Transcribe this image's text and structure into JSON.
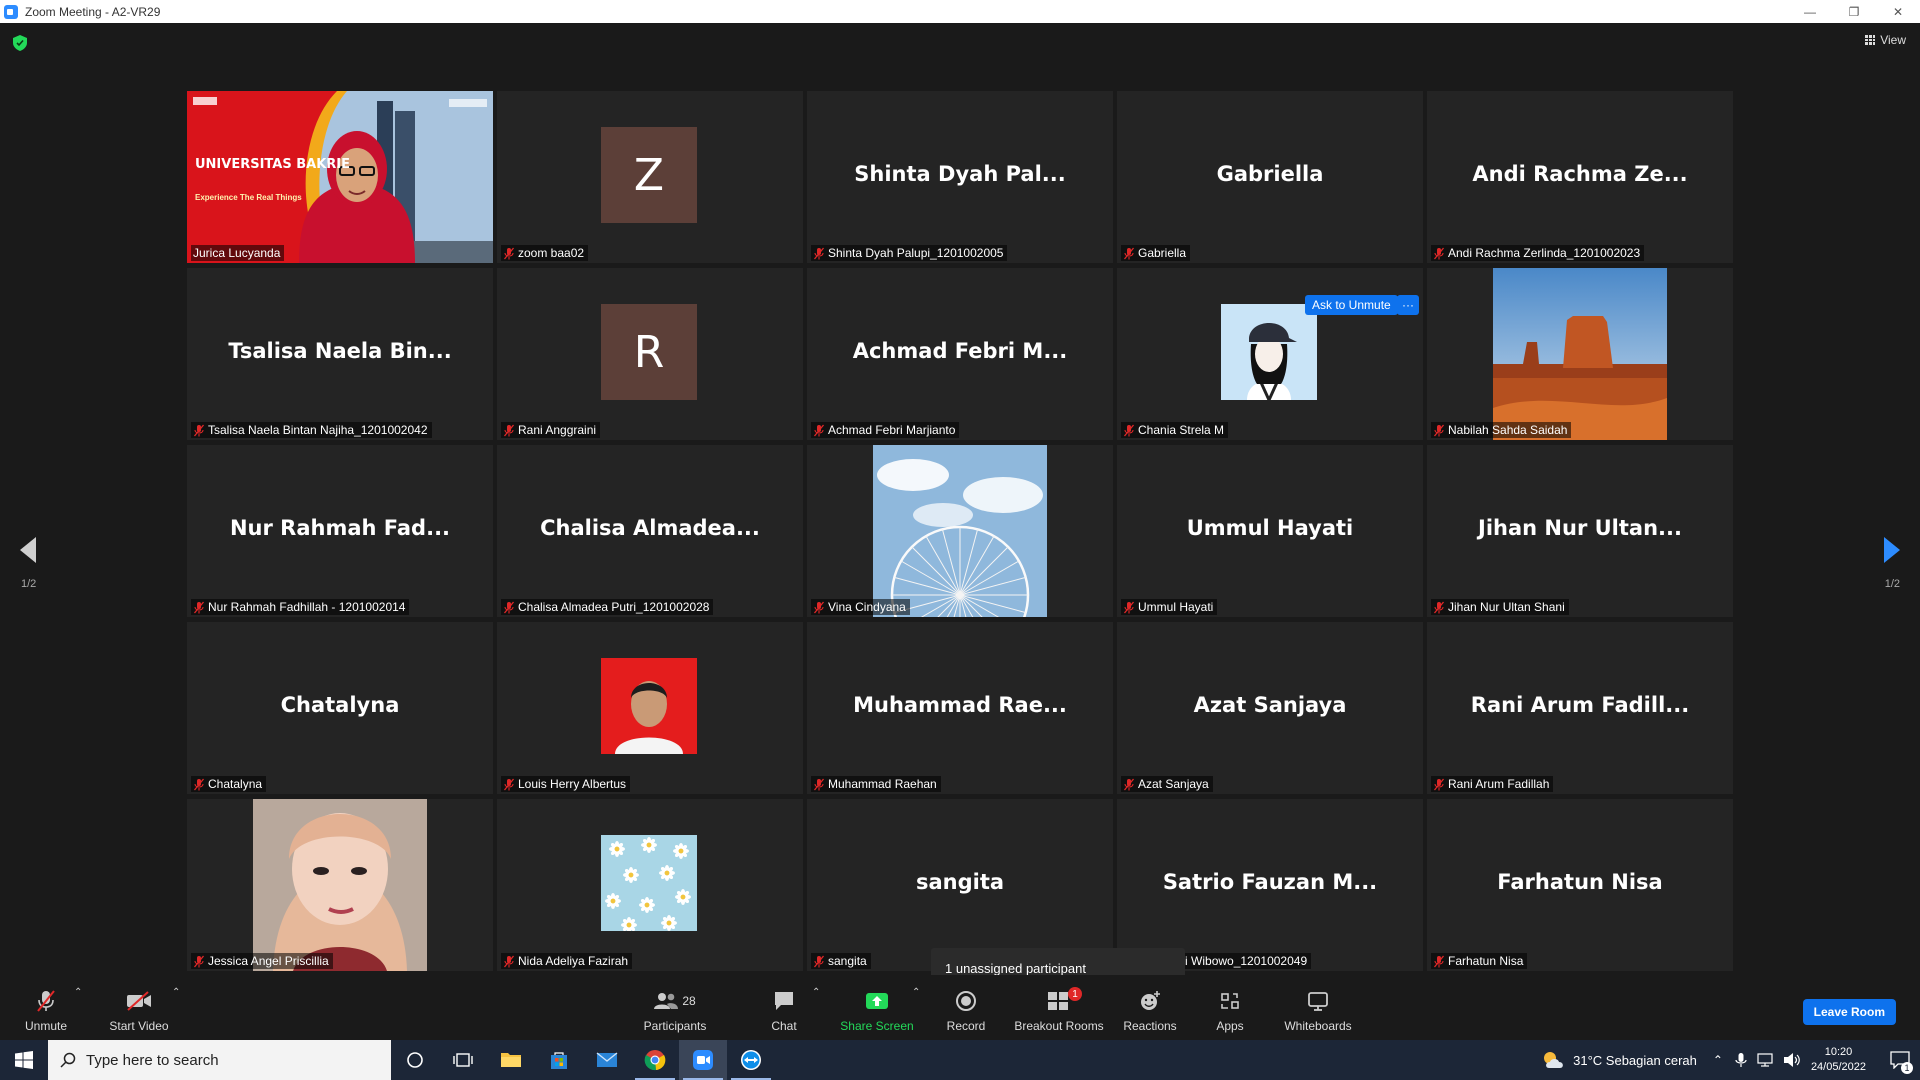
{
  "window": {
    "title": "Zoom Meeting - A2-VR29",
    "minimize": "—",
    "restore": "❐",
    "close": "✕"
  },
  "header": {
    "view_label": "View"
  },
  "tiles": [
    {
      "row": 0,
      "col": 0,
      "label": "Jurica Lucyanda",
      "type": "video",
      "slide_title": "UNIVERSITAS BAKRIE",
      "slide_subtitle": "Experience The Real Things",
      "muted": false,
      "active": true
    },
    {
      "row": 0,
      "col": 1,
      "label": "zoom baa02",
      "type": "letter",
      "letter": "Z",
      "muted": true
    },
    {
      "row": 0,
      "col": 2,
      "label": "Shinta Dyah Palupi_1201002005",
      "type": "name",
      "display": "Shinta Dyah Pal...",
      "muted": true
    },
    {
      "row": 0,
      "col": 3,
      "label": "Gabriella",
      "type": "name",
      "display": "Gabriella",
      "muted": true
    },
    {
      "row": 0,
      "col": 4,
      "label": "Andi Rachma Zerlinda_1201002023",
      "type": "name",
      "display": "Andi Rachma Ze...",
      "muted": true
    },
    {
      "row": 1,
      "col": 0,
      "label": "Tsalisa Naela Bintan Najiha_1201002042",
      "type": "name",
      "display": "Tsalisa Naela Bin...",
      "muted": true
    },
    {
      "row": 1,
      "col": 1,
      "label": "Rani Anggraini",
      "type": "letter",
      "letter": "R",
      "muted": true
    },
    {
      "row": 1,
      "col": 2,
      "label": "Achmad Febri Marjianto",
      "type": "name",
      "display": "Achmad Febri M...",
      "muted": true
    },
    {
      "row": 1,
      "col": 3,
      "label": "Chania Strela M",
      "type": "photo-girl",
      "muted": true
    },
    {
      "row": 1,
      "col": 4,
      "label": "Nabilah Sahda Saidah",
      "type": "photo-desert",
      "muted": true
    },
    {
      "row": 2,
      "col": 0,
      "label": "Nur Rahmah Fadhillah - 1201002014",
      "type": "name",
      "display": "Nur Rahmah Fad...",
      "muted": true
    },
    {
      "row": 2,
      "col": 1,
      "label": "Chalisa Almadea Putri_1201002028",
      "type": "name",
      "display": "Chalisa Almadea...",
      "muted": true
    },
    {
      "row": 2,
      "col": 2,
      "label": "Vina Cindyana",
      "type": "photo-wheel",
      "muted": true
    },
    {
      "row": 2,
      "col": 3,
      "label": "Ummul Hayati",
      "type": "name",
      "display": "Ummul Hayati",
      "muted": true
    },
    {
      "row": 2,
      "col": 4,
      "label": "Jihan Nur Ultan Shani",
      "type": "name",
      "display": "Jihan Nur Ultan...",
      "muted": true
    },
    {
      "row": 3,
      "col": 0,
      "label": "Chatalyna",
      "type": "name",
      "display": "Chatalyna",
      "muted": true
    },
    {
      "row": 3,
      "col": 1,
      "label": "Louis Herry Albertus",
      "type": "photo-man",
      "muted": true
    },
    {
      "row": 3,
      "col": 2,
      "label": "Muhammad Raehan",
      "type": "name",
      "display": "Muhammad Rae...",
      "muted": true
    },
    {
      "row": 3,
      "col": 3,
      "label": "Azat Sanjaya",
      "type": "name",
      "display": "Azat Sanjaya",
      "muted": true
    },
    {
      "row": 3,
      "col": 4,
      "label": "Rani Arum Fadillah",
      "type": "name",
      "display": "Rani Arum Fadill...",
      "muted": true
    },
    {
      "row": 4,
      "col": 0,
      "label": "Jessica Angel Priscillia",
      "type": "photo-woman",
      "muted": true
    },
    {
      "row": 4,
      "col": 1,
      "label": "Nida Adeliya Fazirah",
      "type": "photo-daisy",
      "muted": true
    },
    {
      "row": 4,
      "col": 2,
      "label": "sangita",
      "type": "name",
      "display": "sangita",
      "muted": true
    },
    {
      "row": 4,
      "col": 3,
      "label": "auzan Mukti Wibowo_1201002049",
      "type": "name",
      "display": "Satrio Fauzan M...",
      "muted": false
    },
    {
      "row": 4,
      "col": 4,
      "label": "Farhatun Nisa",
      "type": "name",
      "display": "Farhatun Nisa",
      "muted": true
    }
  ],
  "hover_actions": {
    "ask_unmute": "Ask to Unmute",
    "more": "···"
  },
  "pagination": {
    "left": "1/2",
    "right": "1/2"
  },
  "tooltip": "1 unassigned participant",
  "toolbar": {
    "unmute": "Unmute",
    "start_video": "Start Video",
    "participants": "Participants",
    "participant_count": "28",
    "chat": "Chat",
    "share_screen": "Share Screen",
    "record": "Record",
    "breakout_rooms": "Breakout Rooms",
    "breakout_badge": "1",
    "reactions": "Reactions",
    "apps": "Apps",
    "whiteboards": "Whiteboards",
    "leave": "Leave Room"
  },
  "taskbar": {
    "search_placeholder": "Type here to search",
    "weather": "31°C  Sebagian cerah",
    "time": "10:20",
    "date": "24/05/2022",
    "notification_count": "1"
  },
  "colors": {
    "accent": "#0e72ed",
    "active_speaker": "#f4e542",
    "muted_red": "#e02828",
    "share_green": "#23d959"
  }
}
